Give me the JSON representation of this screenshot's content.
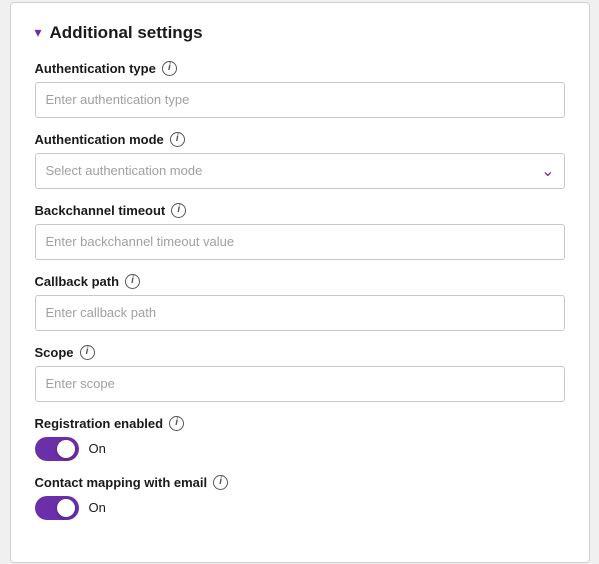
{
  "section": {
    "title": "Additional settings",
    "chevron": "▾"
  },
  "fields": {
    "auth_type": {
      "label": "Authentication type",
      "placeholder": "Enter authentication type"
    },
    "auth_mode": {
      "label": "Authentication mode",
      "placeholder": "Select authentication mode"
    },
    "backchannel_timeout": {
      "label": "Backchannel timeout",
      "placeholder": "Enter backchannel timeout value"
    },
    "callback_path": {
      "label": "Callback path",
      "placeholder": "Enter callback path"
    },
    "scope": {
      "label": "Scope",
      "placeholder": "Enter scope"
    },
    "registration_enabled": {
      "label": "Registration enabled",
      "toggle_on_label": "On",
      "enabled": true
    },
    "contact_mapping": {
      "label": "Contact mapping with email",
      "toggle_on_label": "On",
      "enabled": true
    }
  },
  "icons": {
    "info": "i",
    "chevron_down": "⌄"
  }
}
